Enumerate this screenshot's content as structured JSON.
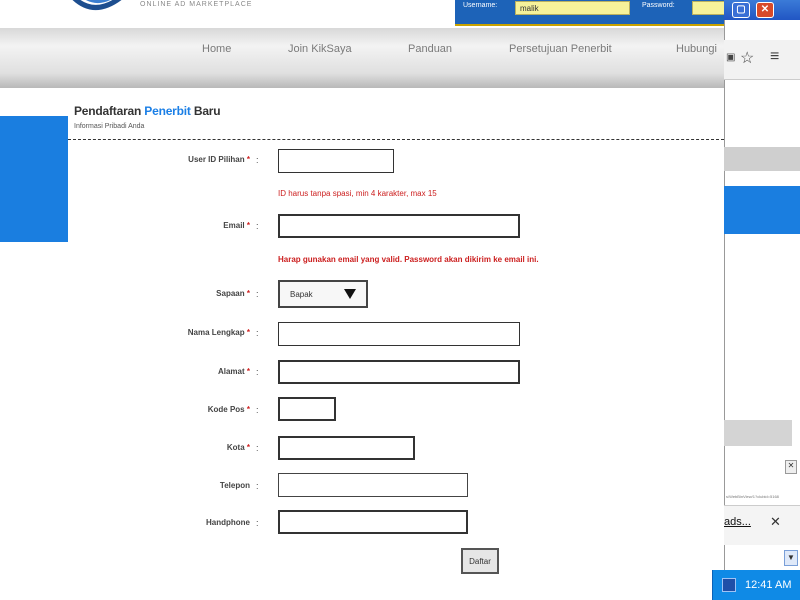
{
  "header": {
    "logo_text": "ONLINE AD MARKETPLACE",
    "login": {
      "username_label": "Username:",
      "username_value": "malik",
      "password_label": "Password:"
    }
  },
  "nav": {
    "items": [
      "Home",
      "Join KikSaya",
      "Panduan",
      "Persetujuan Penerbit",
      "Hubungi"
    ]
  },
  "page": {
    "heading_prefix": "Pendaftaran ",
    "heading_highlight": "Penerbit",
    "heading_suffix": " Baru",
    "subheading": "Informasi Pribadi Anda"
  },
  "form": {
    "fields": {
      "userid_label": "User ID Pilihan",
      "userid_hint": "ID harus tanpa spasi, min 4 karakter, max 15",
      "email_label": "Email",
      "email_hint": "Harap gunakan email yang valid. Password akan dikirim ke email ini.",
      "sapaan_label": "Sapaan",
      "sapaan_value": "Bapak",
      "nama_label": "Nama Lengkap",
      "alamat_label": "Alamat",
      "kodepos_label": "Kode Pos",
      "kota_label": "Kota",
      "telepon_label": "Telepon",
      "handphone_label": "Handphone"
    },
    "required_mark": "*",
    "colon": ":",
    "submit_label": "Daftar"
  },
  "background_window": {
    "tiny_url": "s/WebBinView/1?clubid=5168",
    "download_text": "ads...",
    "close_glyph": "✕"
  },
  "window_controls": {
    "minimize": "▢",
    "close": "✕"
  },
  "taskbar": {
    "time": "12:41 AM"
  },
  "colors": {
    "accent_blue": "#1a7ee0",
    "heading_highlight": "#1b7fe6",
    "error_red": "#cc2020",
    "login_bar": "#1d63b8"
  }
}
